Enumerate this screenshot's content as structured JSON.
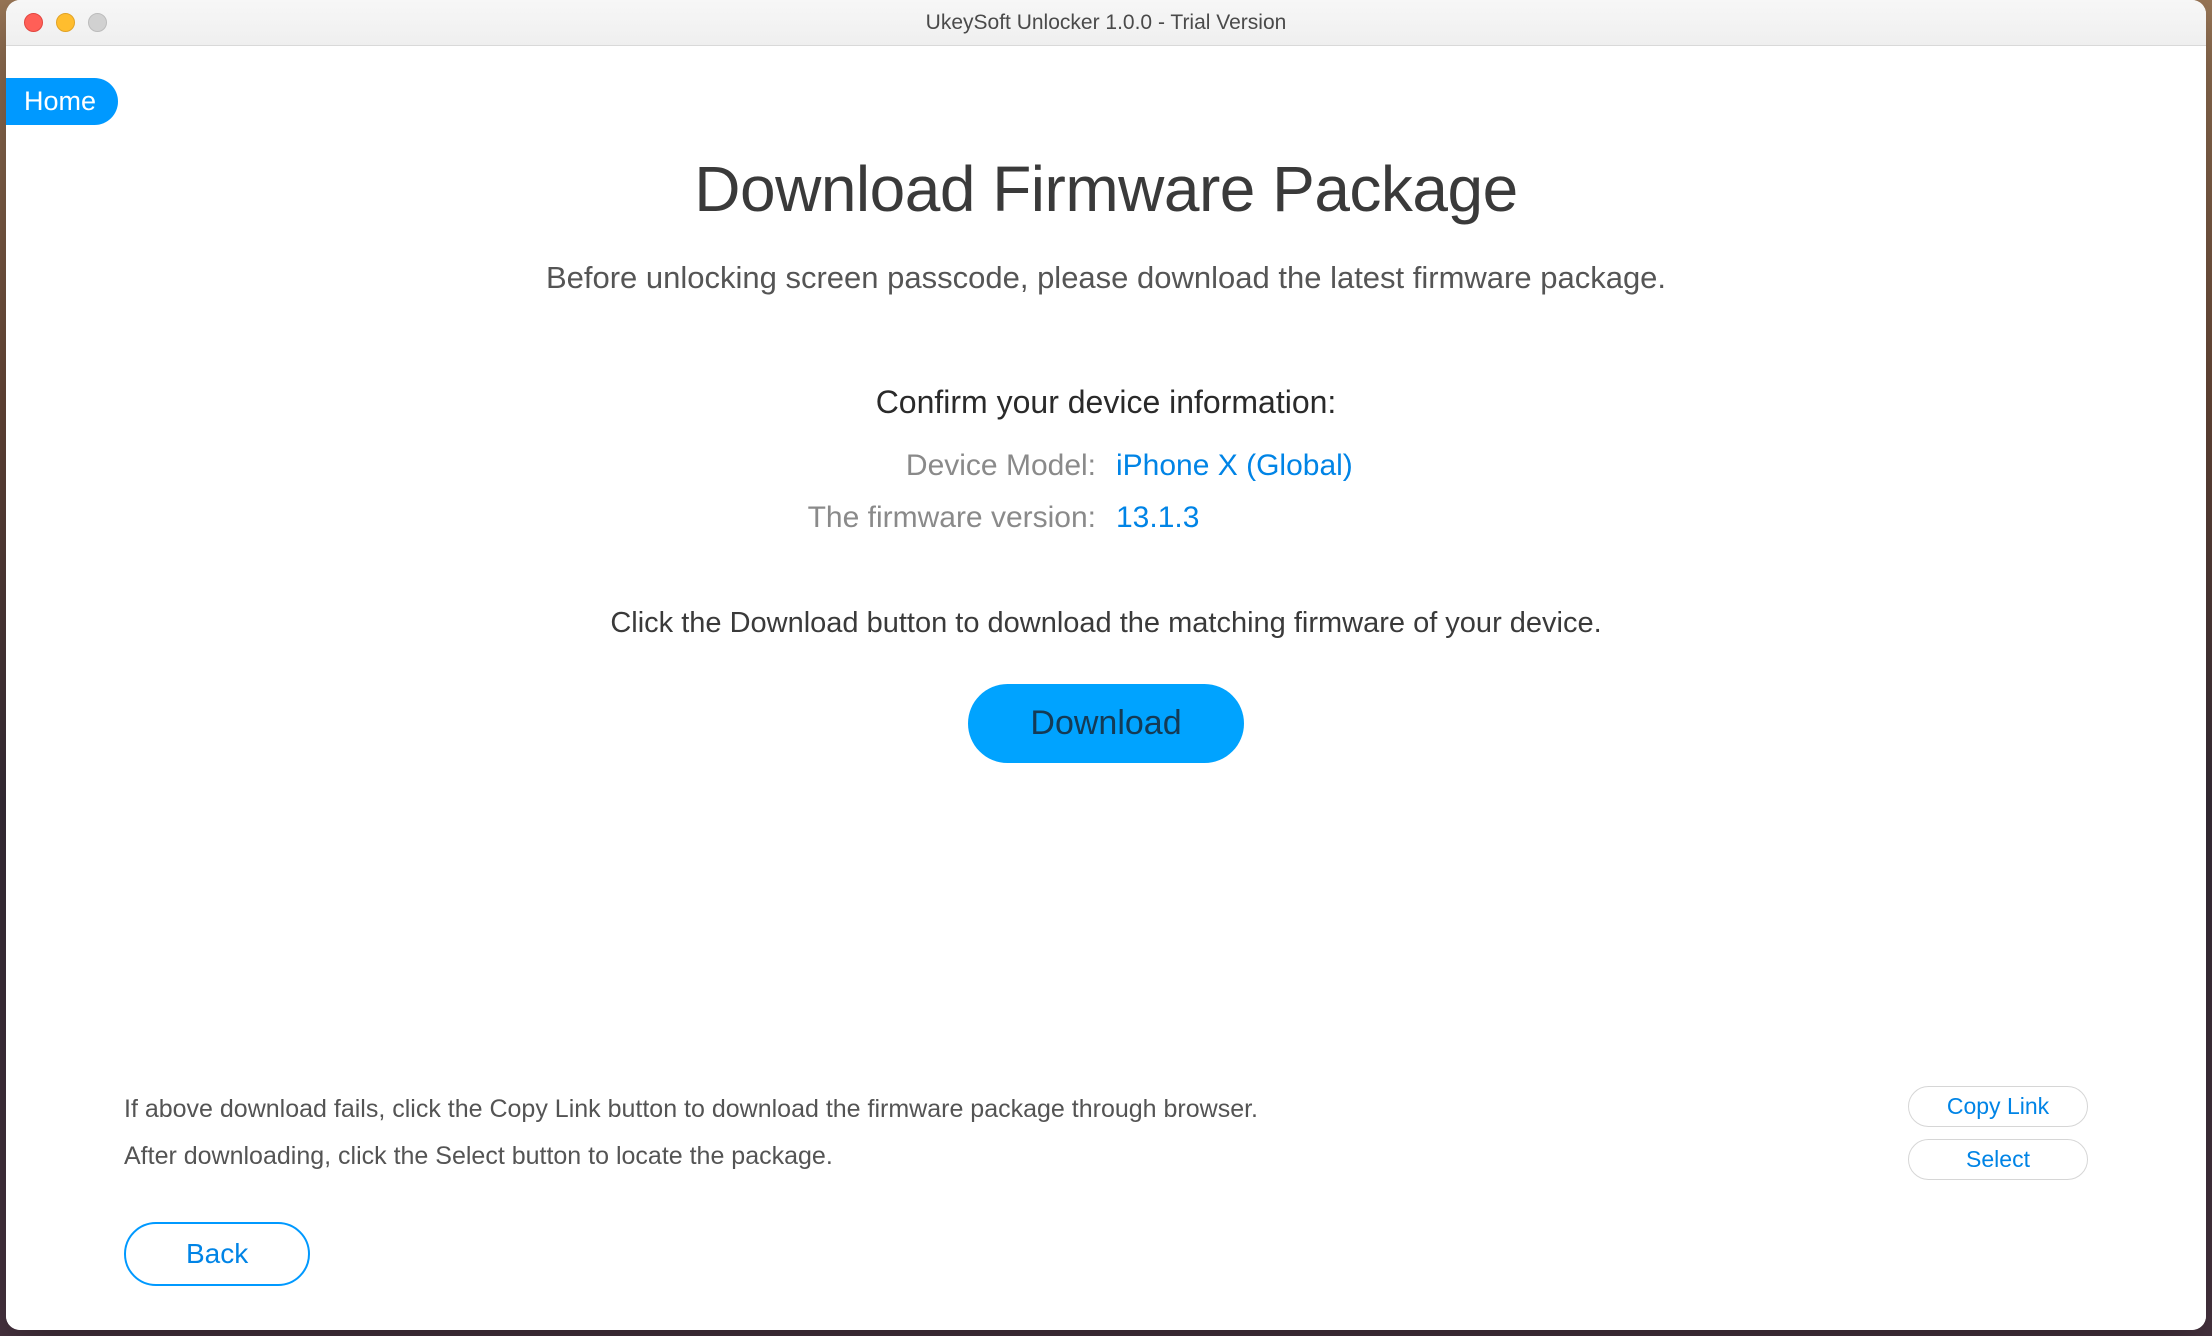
{
  "window": {
    "title": "UkeySoft Unlocker 1.0.0 - Trial Version"
  },
  "nav": {
    "home_label": "Home"
  },
  "main": {
    "heading": "Download Firmware Package",
    "subheading": "Before unlocking screen passcode, please download the latest firmware package.",
    "confirm_heading": "Confirm your device information:",
    "device_model_label": "Device Model:",
    "device_model_value": "iPhone X (Global)",
    "firmware_label": "The firmware version:",
    "firmware_value": "13.1.3",
    "instruction": "Click the Download button to download the matching firmware of your device.",
    "download_label": "Download"
  },
  "help": {
    "line1": "If above download fails, click the Copy Link button to download the firmware package through browser.",
    "line2": "After downloading, click the Select button to locate the package.",
    "copy_link_label": "Copy Link",
    "select_label": "Select"
  },
  "footer": {
    "back_label": "Back"
  },
  "colors": {
    "accent": "#0099ff",
    "link": "#0084e6"
  }
}
